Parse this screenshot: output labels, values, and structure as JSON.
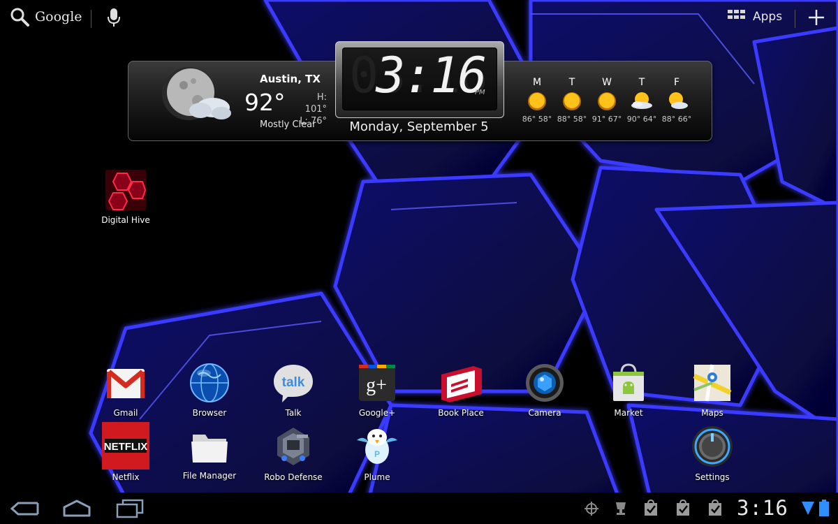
{
  "top_bar": {
    "search_label": "Google",
    "apps_label": "Apps"
  },
  "weather": {
    "city": "Austin, TX",
    "temperature": "92°",
    "high": "H: 101°",
    "low": "L: 76°",
    "condition": "Mostly Clear",
    "clock_ghost": "03:16",
    "clock_time": "3:16",
    "clock_ampm": "PM",
    "date": "Monday, September 5",
    "forecast": [
      {
        "day": "M",
        "temps": "86° 58°",
        "icon": "sun-icon"
      },
      {
        "day": "T",
        "temps": "88° 58°",
        "icon": "sun-icon"
      },
      {
        "day": "W",
        "temps": "91° 67°",
        "icon": "sun-icon"
      },
      {
        "day": "T",
        "temps": "90° 64°",
        "icon": "partly-cloudy-icon"
      },
      {
        "day": "F",
        "temps": "88° 66°",
        "icon": "partly-cloudy-icon"
      }
    ]
  },
  "shortcuts": {
    "digital_hive": "Digital Hive"
  },
  "apps_row1": [
    "Gmail",
    "Browser",
    "Talk",
    "Google+",
    "Book Place",
    "Camera",
    "Market",
    "Maps"
  ],
  "apps_row2": [
    "Netflix",
    "File Manager",
    "Robo Defense",
    "Plume",
    "Settings"
  ],
  "system_bar": {
    "clock": "3:16"
  },
  "colors": {
    "wallpaper_glow": "#2a2aff",
    "sun": "#f5a800"
  }
}
